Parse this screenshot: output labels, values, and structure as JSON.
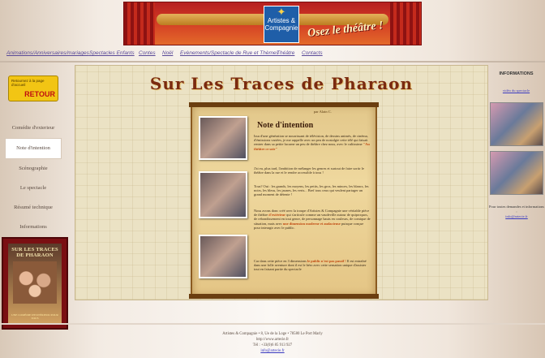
{
  "banner": {
    "logo_line1": "Artistes &",
    "logo_line2": "Compagnie",
    "slogan": "Osez le théâtre !"
  },
  "nav": [
    "Animations/Anniversaires/mariages",
    "Spectacles Enfants",
    "Contes",
    "Noël",
    "Evènements/Spectacle de Rue et Thèmes",
    "Théâtre",
    "Contacts"
  ],
  "back_badge": {
    "small": "Retournez à la page d'accueil",
    "label": "RETOUR"
  },
  "side_menu": [
    {
      "label": "Comédie d'exterieur",
      "active": false
    },
    {
      "label": "Note d'intention",
      "active": true
    },
    {
      "label": "Scénographie",
      "active": false
    },
    {
      "label": "Le spectacle",
      "active": false
    },
    {
      "label": "Résumé technique",
      "active": false
    },
    {
      "label": "Informations",
      "active": false
    }
  ],
  "poster": {
    "title": "SUR LES TRACES DE PHARAON",
    "footer": "UNE COMÉDIE D'EXTÉRIEUR POUR TOUS"
  },
  "main": {
    "title": "Sur Les Traces de Pharaon",
    "byline": "par Alain C.",
    "note_title": "Note d'intention",
    "p1": "Issu d'une génération se nourrissant de télévision, de dessins animés, de cinéma, d'émissions variées, je me rappelle avec un peu de nostalgie cette télé qui faisait rentrer dans sa petite lucarne un peu de théâtre chez nous, avec le cultissime",
    "p1_em": "\"Au théâtre ce soir\"",
    "p2": "J'ai eu, plus tard, l'ambition de mélanger les genres et surtout de faire sortir le théâtre dans la rue et le rendre accessible à tous !",
    "p3": "Tous? Oui : les grands, les moyens, les petits, les gros, les minces, les blancs, les noirs, les bleus, les jaunes, les verts... Bref tous ceux qui veulent partager un grand moment de détente !",
    "p4": "Nous avons donc créé avec la troupe d'Artistes & Compagnie une véritable pièce de théâtre",
    "p4_em": "d'extérieur",
    "p4b": "qui s'articule comme un vaudeville autour de quiproquos, de rebondissement en tout genre, de personnage hauts en couleurs, de comique de situation, mais avec",
    "p4_em2": "une dimension moderne et audacieuse",
    "p4c": "puisque conçue pour interagir avec le public.",
    "p5": "Car dans cette pièce en 3 dimensions",
    "p5_em": "le public n'est pas passif !",
    "p5b": "Il est entraîné dans une folle aventure dont il est le héro avec cette sensation unique d'assister tout en faisant partie du spectacle"
  },
  "right": {
    "heading": "INFORMATIONS",
    "video_link": "vidéo du spectacle",
    "contact_text": "Pour toutes demandes et informations :",
    "contact_mail": "info@artecie.fr"
  },
  "footer": {
    "line1": "Artistes & Compagnie • 8, Ue de la Loge • 78580 Le Port Marly",
    "line2": "http://www.artecie.fr",
    "line3": "Tél : +33(0)6 85 913 927",
    "mail": "info@artecie.fr"
  }
}
